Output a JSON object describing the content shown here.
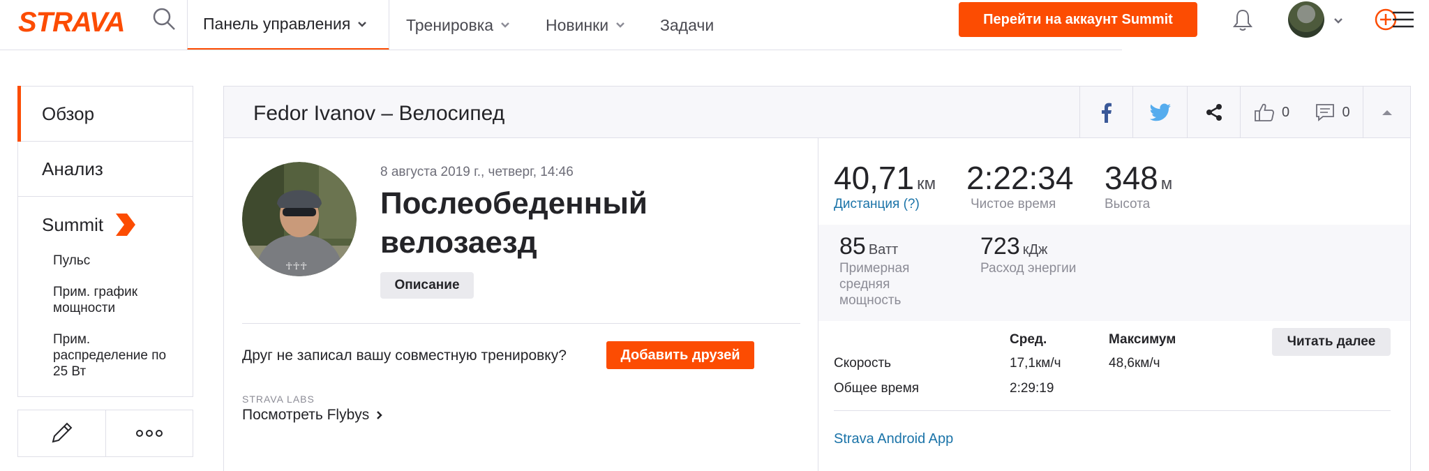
{
  "brand": {
    "logo_text": "STRAVA",
    "accent": "#fc4c02",
    "link": "#1a73a8"
  },
  "nav": {
    "tabs": [
      {
        "label": "Панель управления",
        "has_dropdown": true,
        "active": true
      },
      {
        "label": "Тренировка",
        "has_dropdown": true
      },
      {
        "label": "Новинки",
        "has_dropdown": true
      },
      {
        "label": "Задачи",
        "has_dropdown": false
      }
    ],
    "summit_button": "Перейти на аккаунт Summit"
  },
  "sidebar": {
    "items": [
      {
        "label": "Обзор",
        "active": true
      },
      {
        "label": "Анализ"
      }
    ],
    "summit": {
      "label": "Summit",
      "sub_items": [
        {
          "label": "Пульс"
        },
        {
          "label": "Прим. график мощности"
        },
        {
          "label": "Прим. распределение по 25 Вт"
        }
      ]
    },
    "actions": [
      {
        "icon": "pencil-icon"
      },
      {
        "icon": "more-icon"
      }
    ]
  },
  "activity": {
    "header_title": "Fedor Ivanov – Велосипед",
    "kudos_count": "0",
    "comments_count": "0",
    "date": "8 августа 2019 г., четверг, 14:46",
    "name": "Послеобеденный велозаезд",
    "description_button": "Описание",
    "friend_question": "Друг не записал вашу совместную тренировку?",
    "add_friends_button": "Добавить друзей",
    "labs_label": "STRAVA LABS",
    "flybys_link": "Посмотреть Flybys"
  },
  "stats": {
    "primary": [
      {
        "value": "40,71",
        "unit": "км",
        "label": "Дистанция (?)"
      },
      {
        "value": "2:22:34",
        "unit": "",
        "label": "Чистое время"
      },
      {
        "value": "348",
        "unit": "м",
        "label": "Высота"
      }
    ],
    "secondary": [
      {
        "value": "85",
        "unit": "Ватт",
        "label": "Примерная средняя мощность"
      },
      {
        "value": "723",
        "unit": "кДж",
        "label": "Расход энергии"
      }
    ],
    "table": {
      "headers": {
        "avg": "Сред.",
        "max": "Максимум"
      },
      "rows": [
        {
          "label": "Скорость",
          "avg": "17,1км/ч",
          "max": "48,6км/ч"
        },
        {
          "label": "Общее время",
          "avg": "2:29:19",
          "max": ""
        }
      ],
      "read_more": "Читать далее"
    },
    "device": "Strava Android App"
  }
}
